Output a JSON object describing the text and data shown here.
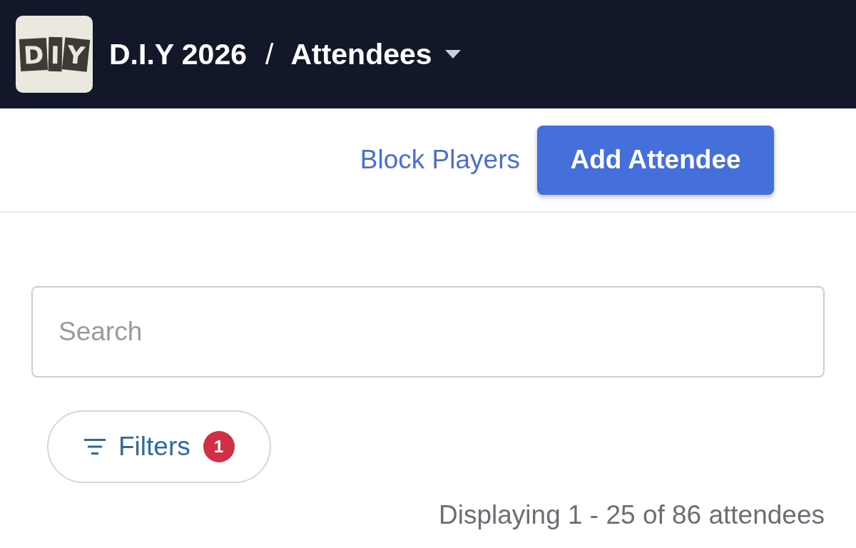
{
  "header": {
    "logo_letters": [
      "D",
      "I",
      "Y"
    ],
    "event": "D.I.Y 2026",
    "separator": "/",
    "section": "Attendees"
  },
  "toolbar": {
    "link": "Block Players",
    "primary_button": "Add Attendee"
  },
  "search": {
    "placeholder": "Search"
  },
  "filters": {
    "label": "Filters",
    "count": "1"
  },
  "summary": "Displaying 1 - 25 of 86 attendees"
}
